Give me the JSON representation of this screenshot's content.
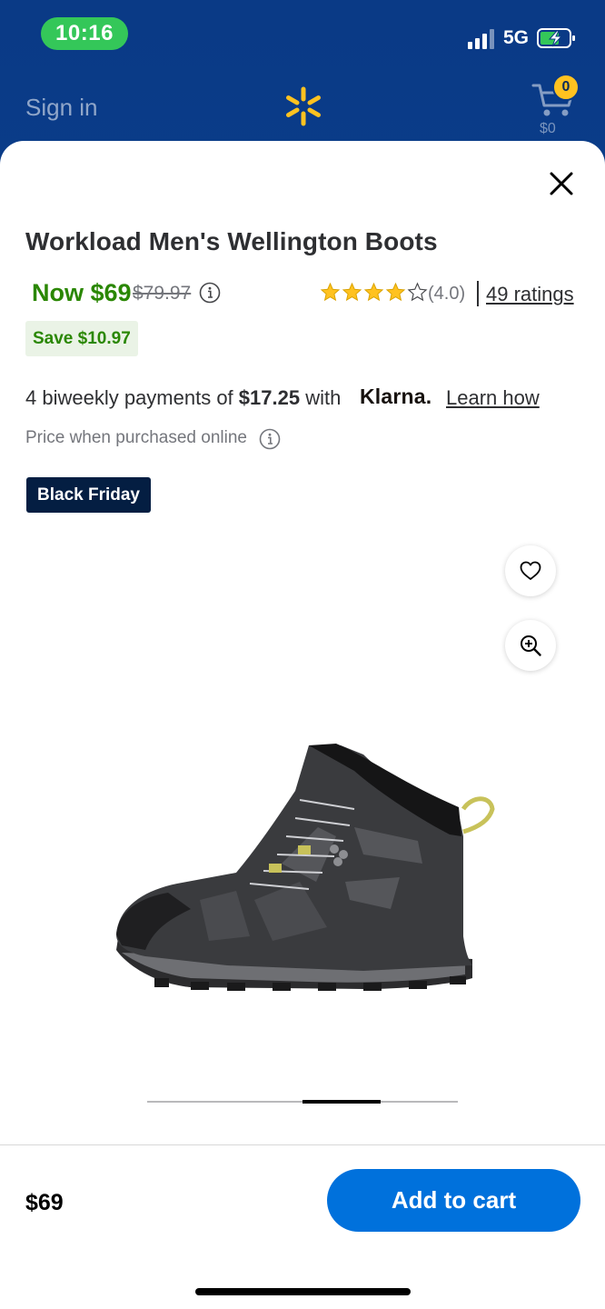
{
  "status_bar": {
    "time": "10:16",
    "network": "5G"
  },
  "header": {
    "sign_in": "Sign in",
    "cart_count": "0",
    "cart_total": "$0"
  },
  "product": {
    "title": "Workload Men's Wellington Boots",
    "price_now": "Now $69",
    "price_was": "$79.97",
    "rating_value": "(4.0)",
    "rating_stars": 4,
    "ratings_link": "49 ratings",
    "save_label": "Save $10.97",
    "payments_prefix": "4 biweekly payments of ",
    "payments_amount": "$17.25",
    "payments_suffix": " with",
    "klarna_logo": "Klarna.",
    "learn_how": "Learn how",
    "price_online": "Price when purchased online",
    "black_friday": "Black Friday"
  },
  "icons": {
    "close": "close-icon",
    "favorite": "heart-icon",
    "zoom": "zoom-in-icon",
    "info": "info-icon",
    "cart": "cart-icon",
    "spark": "walmart-spark-icon"
  },
  "carousel": {
    "active_index": 2,
    "total": 4
  },
  "footer": {
    "price": "$69",
    "add_to_cart": "Add to cart"
  },
  "colors": {
    "brand_blue": "#0a3a86",
    "accent_blue": "#0071dc",
    "price_green": "#2a8703",
    "star": "#ffc220",
    "spark": "#ffc220",
    "badge_navy": "#041e42"
  }
}
